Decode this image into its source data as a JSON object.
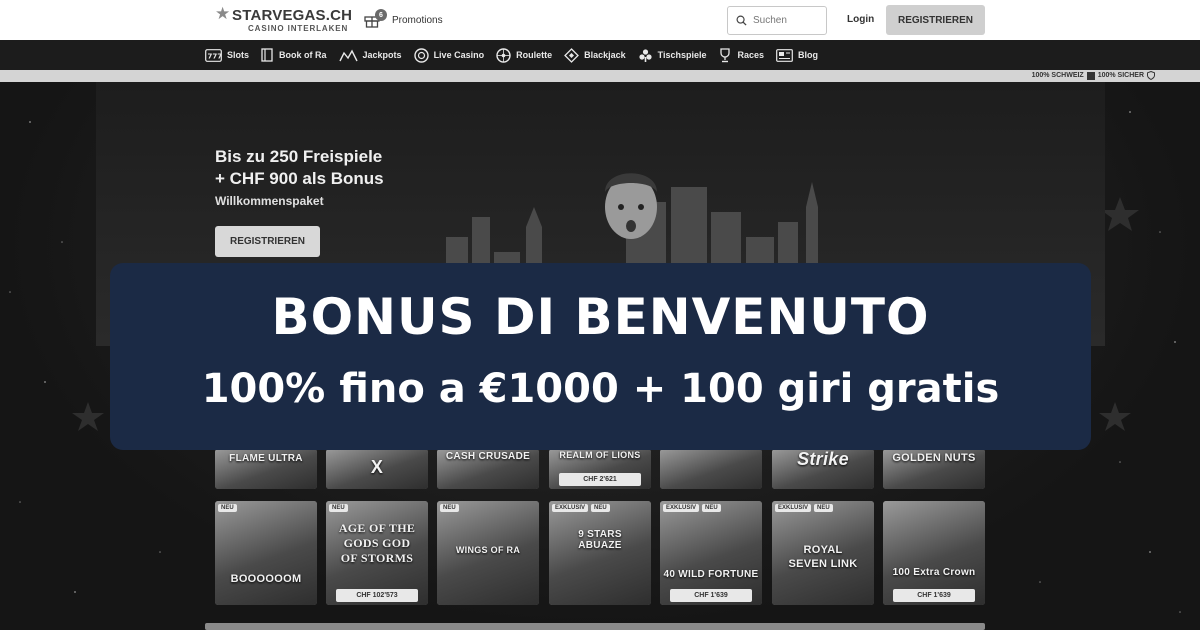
{
  "header": {
    "logo_text": "STARVEGAS.CH",
    "logo_subtext": "CASINO INTERLAKEN",
    "promotions_label": "Promotions",
    "promotions_badge": "6",
    "search_placeholder": "Suchen",
    "login_label": "Login",
    "register_label": "REGISTRIEREN"
  },
  "nav": {
    "items": [
      {
        "label": "Slots",
        "icon": "slot-machine-icon"
      },
      {
        "label": "Book of Ra",
        "icon": "book-icon"
      },
      {
        "label": "Jackpots",
        "icon": "jackpot-icon"
      },
      {
        "label": "Live Casino",
        "icon": "chip-icon"
      },
      {
        "label": "Roulette",
        "icon": "roulette-icon"
      },
      {
        "label": "Blackjack",
        "icon": "card-icon"
      },
      {
        "label": "Tischspiele",
        "icon": "table-games-icon"
      },
      {
        "label": "Races",
        "icon": "trophy-icon"
      },
      {
        "label": "Blog",
        "icon": "blog-icon"
      }
    ]
  },
  "trust": {
    "left": "100% SCHWEIZ",
    "right": "100% SICHER"
  },
  "hero": {
    "line1": "Bis zu 250 Freispiele",
    "line2": "+ CHF 900 als Bonus",
    "subtitle": "Willkommenspaket",
    "button_label": "REGISTRIEREN"
  },
  "banner": {
    "title": "BONUS DI BENVENUTO",
    "subtitle": "100% fino a €1000 + 100 giri gratis"
  },
  "games_top": [
    {
      "title": "FLAME ULTRA",
      "jackpot": ""
    },
    {
      "title": "X",
      "jackpot": ""
    },
    {
      "title": "CASH CRUSADE",
      "jackpot": ""
    },
    {
      "title": "REALM OF LIONS",
      "jackpot": "CHF 2'621"
    },
    {
      "title": "",
      "jackpot": ""
    },
    {
      "title": "Strike",
      "jackpot": ""
    },
    {
      "title": "GOLDEN NUTS",
      "jackpot": ""
    }
  ],
  "games_bottom": [
    {
      "title": "BOOOOOOM",
      "tag1": "NEU",
      "tag2": "",
      "jackpot": ""
    },
    {
      "title": "AGE OF THE GODS GOD OF STORMS",
      "tag1": "NEU",
      "tag2": "",
      "jackpot": "CHF 102'573"
    },
    {
      "title": "WINGS OF RA",
      "tag1": "NEU",
      "tag2": "",
      "jackpot": ""
    },
    {
      "title": "9 STARS ABUAZE",
      "tag1": "EXKLUSIV",
      "tag2": "NEU",
      "jackpot": ""
    },
    {
      "title": "40 WILD FORTUNE",
      "tag1": "EXKLUSIV",
      "tag2": "NEU",
      "jackpot": "CHF 1'639"
    },
    {
      "title": "ROYAL SEVEN LINK",
      "tag1": "EXKLUSIV",
      "tag2": "NEU",
      "jackpot": ""
    },
    {
      "title": "100 Extra Crown",
      "tag1": "",
      "tag2": "",
      "jackpot": "CHF 1'639"
    }
  ]
}
